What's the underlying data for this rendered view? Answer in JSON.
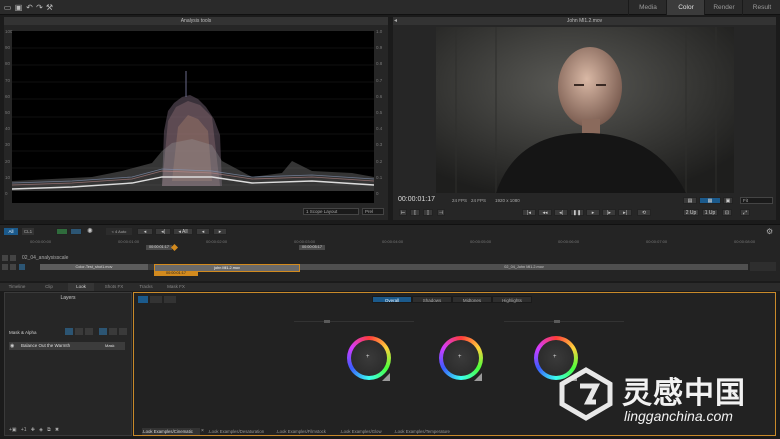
{
  "toolbar": {
    "icons": [
      "folder-icon",
      "save-icon",
      "undo-icon",
      "redo-icon",
      "wrench-icon"
    ]
  },
  "modes": [
    {
      "label": "Media"
    },
    {
      "label": "Color"
    },
    {
      "label": "Render"
    },
    {
      "label": "Result"
    }
  ],
  "active_mode": "Color",
  "scope": {
    "title": "Analysis tools",
    "y_labels": [
      "100",
      "90",
      "80",
      "70",
      "60",
      "50",
      "40",
      "30",
      "20",
      "10",
      "0"
    ],
    "right_labels": [
      "1.0",
      "0.9",
      "0.8",
      "0.7",
      "0.6",
      "0.5",
      "0.4",
      "0.3",
      "0.2",
      "0.1",
      "0"
    ],
    "layout_select": "1 Scope Layout",
    "mode_select": "Prel"
  },
  "viewer": {
    "title": "John Ml1.2.mov",
    "timecode": "00:00:01:17",
    "fps1": "24 FPS",
    "fps2": "24 FPS",
    "resolution": "1920 x 1080",
    "fit": "Fit",
    "btn_up": "2 Up",
    "btn_clip": "1 Up"
  },
  "timeline": {
    "all_label": "All",
    "clip_label": "CL1",
    "timecodes": [
      "00:00:00:00",
      "00:00:01:00",
      "00:00:02:00",
      "00:00:03:00",
      "00:00:04:00",
      "00:00:05:00",
      "00:00:06:00",
      "00:00:07:00",
      "00:00:08:00"
    ],
    "in_mark": "00:00:01:17",
    "out_mark": "00:00:05:17",
    "track_name": "02_04_analysisscale",
    "clip_a": "Color-Test_shot1.mov",
    "clip_b": "john Ml1.2.mov",
    "clip_c": "02_04_John Ml1.2.mov",
    "orange_tc": "00:00:01:17"
  },
  "panel_tabs": [
    {
      "label": "Timeline"
    },
    {
      "label": "Clip"
    },
    {
      "label": "Look"
    },
    {
      "label": "Shots FX"
    },
    {
      "label": "Tracks"
    },
    {
      "label": "Mask FX"
    }
  ],
  "layers": {
    "title": "Layers",
    "mask_label": "Mask & Alpha",
    "layer_item": "Balance Out the Warmth",
    "layer_badge": "Mask"
  },
  "looks": {
    "segments": [
      "Overall",
      "Shadows",
      "Midtones",
      "Highlights"
    ],
    "active_segment": "Overall",
    "bottom_tabs": [
      ".Look Examples/Cinematic",
      ".Look Examples/Desaturation",
      ".Look Examples/Filmstock",
      ".Look Examples/Glow",
      ".Look Examples/Temperature"
    ]
  },
  "watermark": {
    "brand": "灵感中国",
    "url": "lingganchina.com"
  }
}
